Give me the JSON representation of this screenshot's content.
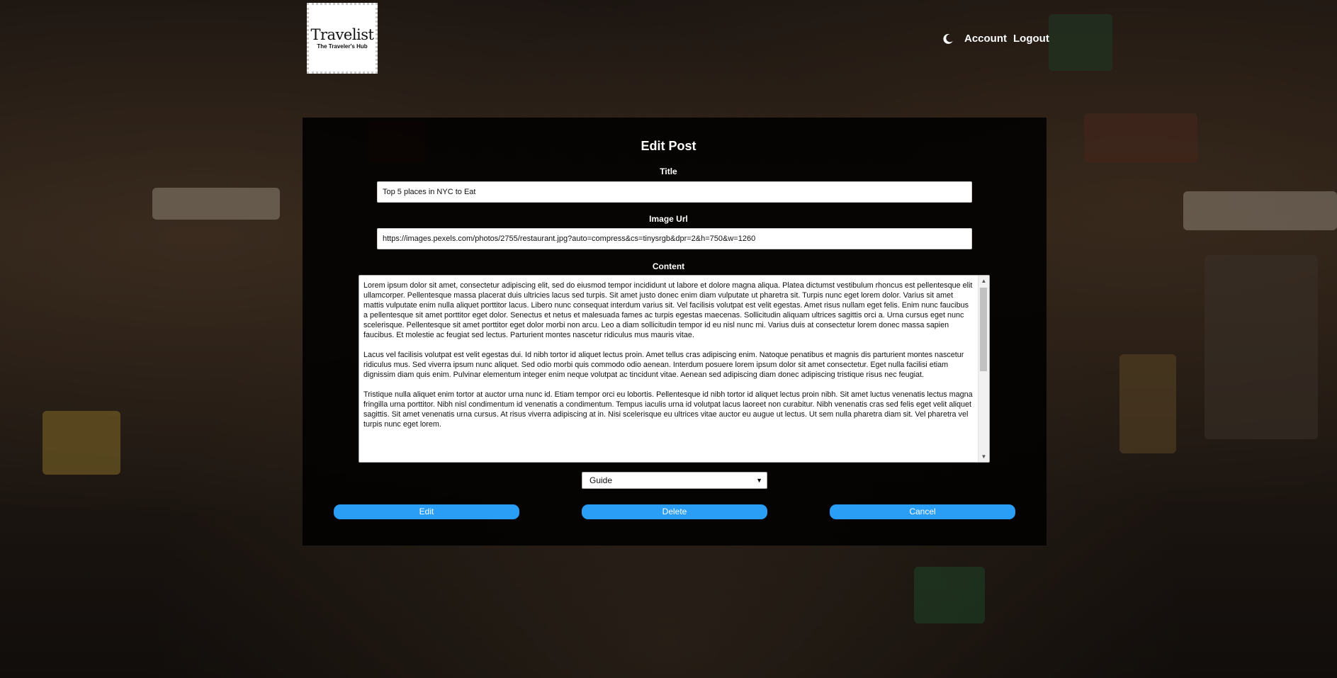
{
  "brand": {
    "name": "Travelist",
    "tagline": "The Traveler's Hub"
  },
  "nav": {
    "theme_icon": "moon-icon",
    "account_label": "Account",
    "logout_label": "Logout"
  },
  "form": {
    "heading": "Edit Post",
    "title_label": "Title",
    "title_value": "Top 5 places in NYC to Eat",
    "image_label": "Image Url",
    "image_value": "https://images.pexels.com/photos/2755/restaurant.jpg?auto=compress&cs=tinysrgb&dpr=2&h=750&w=1260",
    "content_label": "Content",
    "content_paragraphs": [
      "Lorem ipsum dolor sit amet, consectetur adipiscing elit, sed do eiusmod tempor incididunt ut labore et dolore magna aliqua. Platea dictumst vestibulum rhoncus est pellentesque elit ullamcorper. Pellentesque massa placerat duis ultricies lacus sed turpis. Sit amet justo donec enim diam vulputate ut pharetra sit. Turpis nunc eget lorem dolor. Varius sit amet mattis vulputate enim nulla aliquet porttitor lacus. Libero nunc consequat interdum varius sit. Vel facilisis volutpat est velit egestas. Amet risus nullam eget felis. Enim nunc faucibus a pellentesque sit amet porttitor eget dolor. Senectus et netus et malesuada fames ac turpis egestas maecenas. Sollicitudin aliquam ultrices sagittis orci a. Urna cursus eget nunc scelerisque. Pellentesque sit amet porttitor eget dolor morbi non arcu. Leo a diam sollicitudin tempor id eu nisl nunc mi. Varius duis at consectetur lorem donec massa sapien faucibus. Et molestie ac feugiat sed lectus. Parturient montes nascetur ridiculus mus mauris vitae.",
      "Lacus vel facilisis volutpat est velit egestas dui. Id nibh tortor id aliquet lectus proin. Amet tellus cras adipiscing enim. Natoque penatibus et magnis dis parturient montes nascetur ridiculus mus. Sed viverra ipsum nunc aliquet. Sed odio morbi quis commodo odio aenean. Interdum posuere lorem ipsum dolor sit amet consectetur. Eget nulla facilisi etiam dignissim diam quis enim. Pulvinar elementum integer enim neque volutpat ac tincidunt vitae. Aenean sed adipiscing diam donec adipiscing tristique risus nec feugiat.",
      "Tristique nulla aliquet enim tortor at auctor urna nunc id. Etiam tempor orci eu lobortis. Pellentesque id nibh tortor id aliquet lectus proin nibh. Sit amet luctus venenatis lectus magna fringilla urna porttitor. Nibh nisl condimentum id venenatis a condimentum. Tempus iaculis urna id volutpat lacus laoreet non curabitur. Nibh venenatis cras sed felis eget velit aliquet sagittis. Sit amet venenatis urna cursus. At risus viverra adipiscing at in. Nisi scelerisque eu ultrices vitae auctor eu augue ut lectus. Ut sem nulla pharetra diam sit. Vel pharetra vel turpis nunc eget lorem."
    ],
    "category_value": "Guide",
    "edit_label": "Edit",
    "delete_label": "Delete",
    "cancel_label": "Cancel"
  },
  "colors": {
    "button": "#2a9df4",
    "panel": "#000000"
  }
}
